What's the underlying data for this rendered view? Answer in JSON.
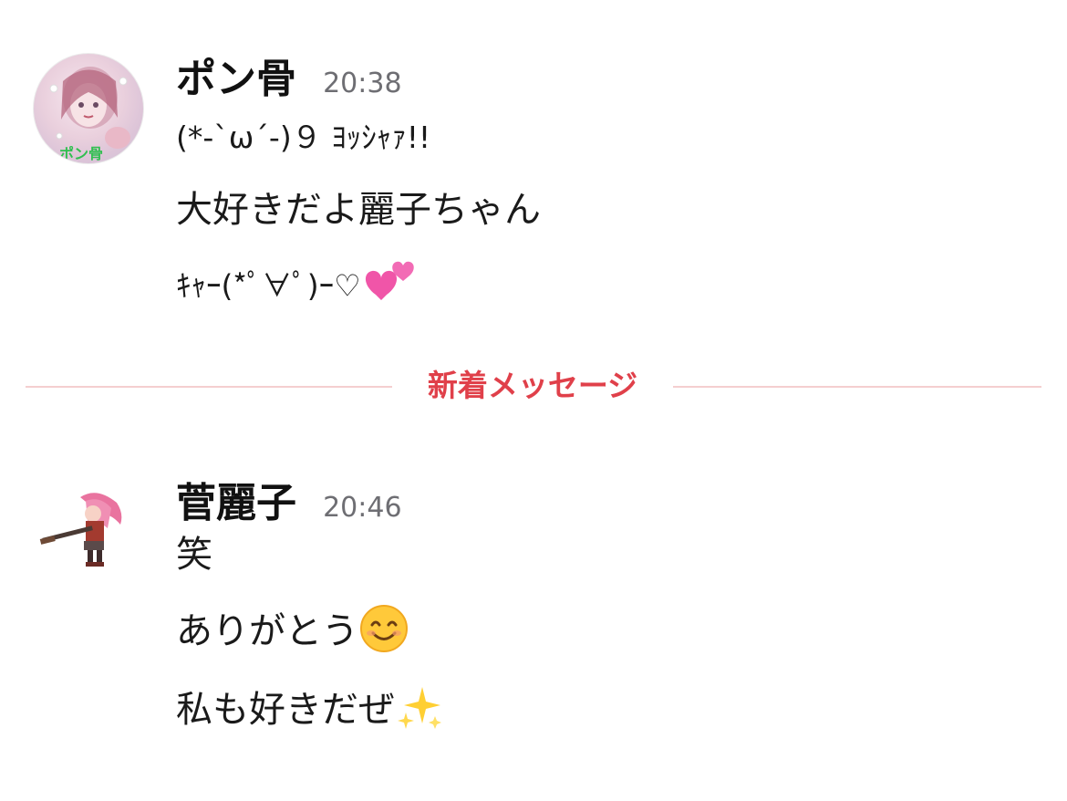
{
  "messages": [
    {
      "author": "ポン骨",
      "time": "20:38",
      "avatar_text": "ポン骨",
      "lines": [
        "(*-`ω´-)９ ﾖｯｼｬｧ!!",
        "大好きだよ麗子ちゃん",
        "ｷｬｰ(*ﾟ∀ﾟ)ｰ♡"
      ],
      "line3_emoji": "two-hearts-icon"
    },
    {
      "author": "菅麗子",
      "time": "20:46",
      "lines": [
        "笑",
        "ありがとう",
        "私も好きだぜ"
      ],
      "line2_emoji": "smiling-face-icon",
      "line3_emoji": "sparkles-icon"
    }
  ],
  "divider": {
    "label": "新着メッセージ"
  },
  "colors": {
    "divider_text": "#e0404a",
    "divider_line": "#f5cfd0",
    "timestamp": "#6e6e73"
  }
}
